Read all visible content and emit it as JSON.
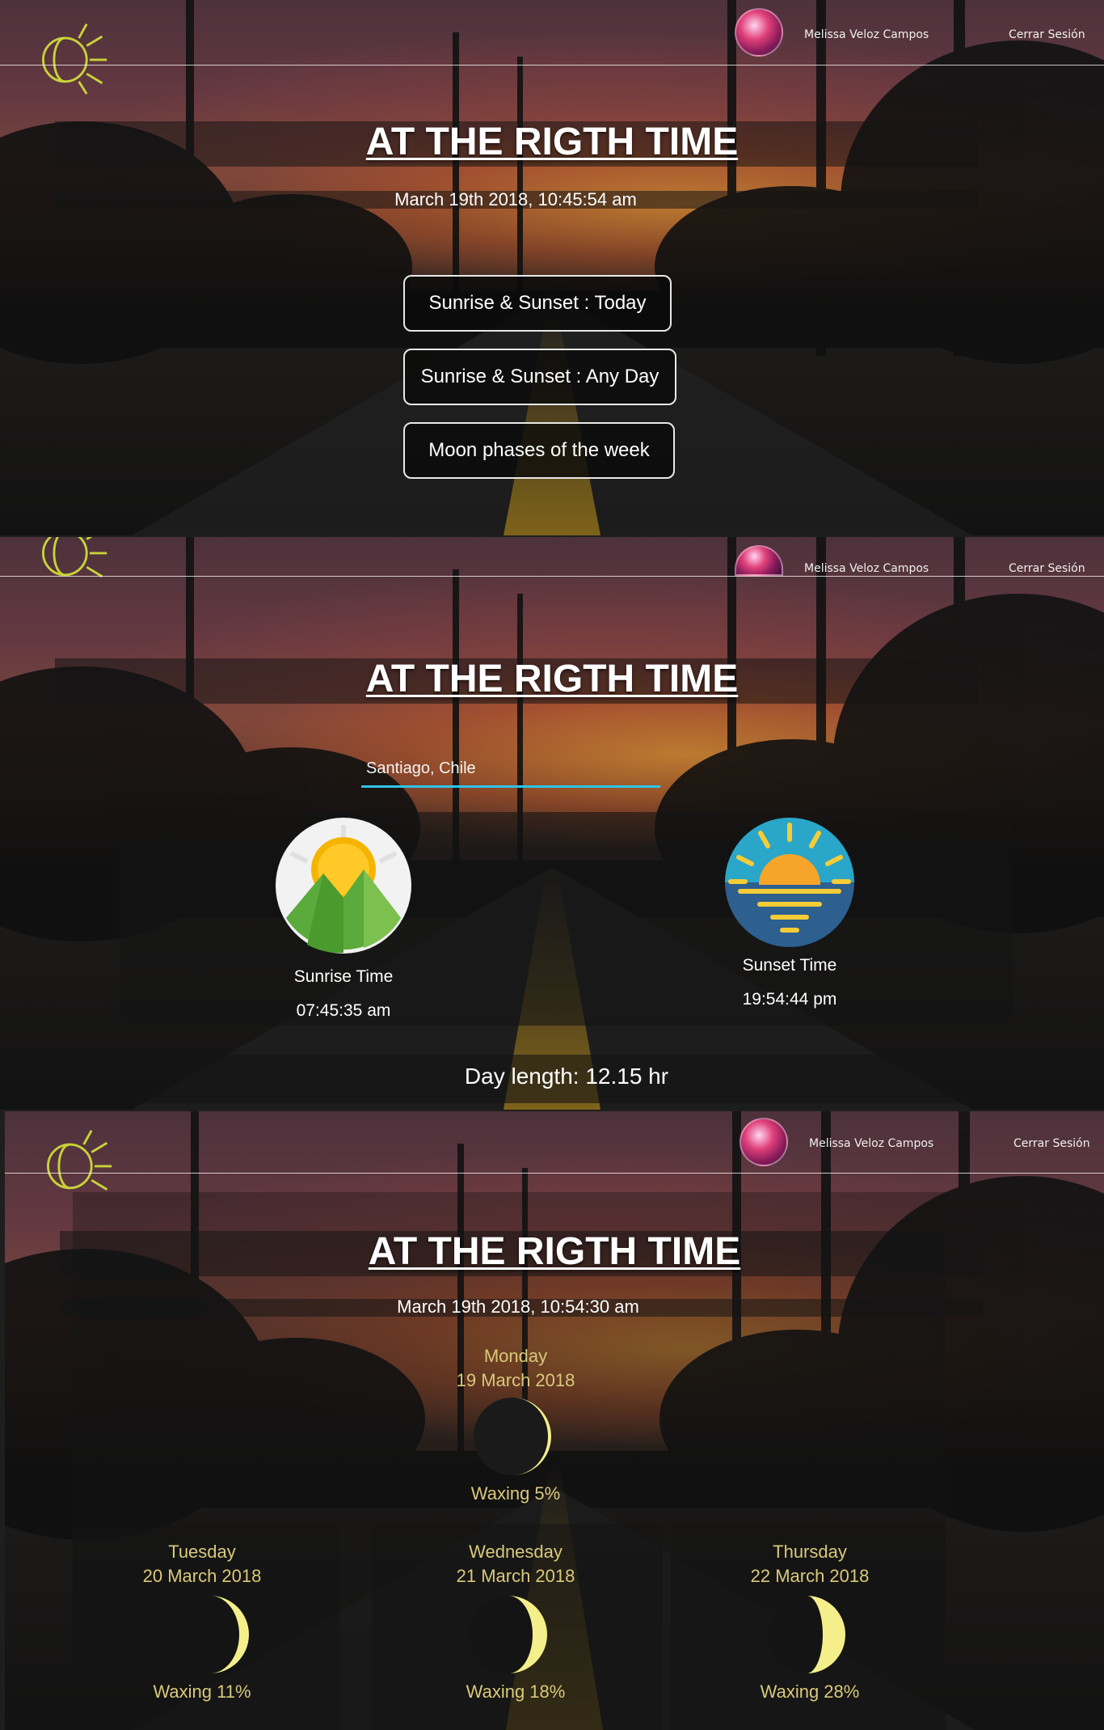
{
  "header": {
    "user_name": "Melissa Veloz Campos",
    "logout_label": "Cerrar Sesión"
  },
  "app": {
    "title": "AT THE RIGTH TIME"
  },
  "home": {
    "datetime": "March 19th 2018, 10:45:54 am",
    "menu": [
      {
        "label": "Sunrise & Sunset : Today"
      },
      {
        "label": "Sunrise & Sunset : Any Day"
      },
      {
        "label": "Moon phases of the week"
      }
    ]
  },
  "sun": {
    "city_value": "Santiago, Chile",
    "sunrise_label": "Sunrise Time",
    "sunrise_time": "07:45:35 am",
    "sunset_label": "Sunset Time",
    "sunset_time": "19:54:44 pm",
    "day_length": "Day length: 12.15 hr"
  },
  "moon": {
    "datetime": "March 19th 2018, 10:54:30 am",
    "today": {
      "day": "Monday",
      "date": "19 March 2018",
      "status": "Waxing 5%",
      "illumination": 0.05
    },
    "week": [
      {
        "day": "Tuesday",
        "date": "20 March 2018",
        "status": "Waxing 11%",
        "illumination": 0.11
      },
      {
        "day": "Wednesday",
        "date": "21 March 2018",
        "status": "Waxing 18%",
        "illumination": 0.18
      },
      {
        "day": "Thursday",
        "date": "22 March 2018",
        "status": "Waxing 28%",
        "illumination": 0.28
      }
    ]
  },
  "colors": {
    "accent": "#2ec4e8",
    "moon_text": "#d9c97a",
    "moon_light": "#f4ef8a"
  }
}
